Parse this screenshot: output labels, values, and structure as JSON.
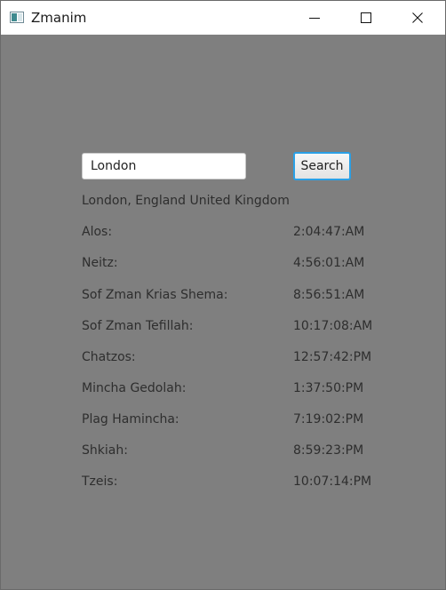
{
  "window": {
    "title": "Zmanim",
    "app_icon": "java-app-icon",
    "controls": [
      "minimize-icon",
      "maximize-icon",
      "close-icon"
    ]
  },
  "search": {
    "value": "London",
    "button_label": "Search"
  },
  "location": "London, England United Kingdom",
  "zmanim": [
    {
      "label": "Alos:",
      "time": "2:04:47:AM"
    },
    {
      "label": "Neitz:",
      "time": "4:56:01:AM"
    },
    {
      "label": "Sof Zman Krias Shema:",
      "time": "8:56:51:AM"
    },
    {
      "label": "Sof Zman Tefillah:",
      "time": "10:17:08:AM"
    },
    {
      "label": "Chatzos:",
      "time": "12:57:42:PM"
    },
    {
      "label": "Mincha Gedolah:",
      "time": "1:37:50:PM"
    },
    {
      "label": "Plag Hamincha:",
      "time": "7:19:02:PM"
    },
    {
      "label": "Shkiah:",
      "time": "8:59:23:PM"
    },
    {
      "label": "Tzeis:",
      "time": "10:07:14:PM"
    }
  ],
  "colors": {
    "background": "#7f7f7f",
    "focus_border": "#2aa0e6"
  }
}
